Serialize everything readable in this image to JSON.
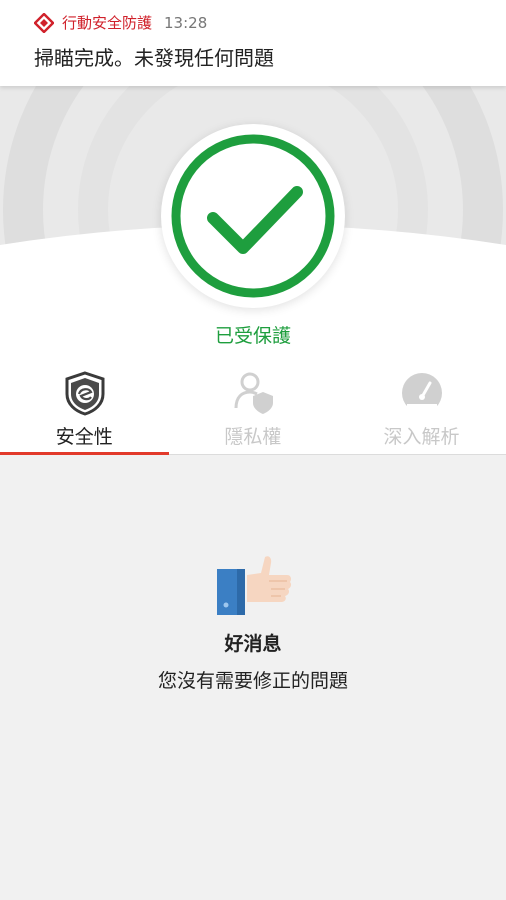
{
  "notification": {
    "app_name": "行動安全防護",
    "time": "13:28",
    "message": "掃瞄完成。未發現任何問題"
  },
  "hero": {
    "status_label": "已受保護",
    "status_icon": "checkmark-circle-icon"
  },
  "tabs": [
    {
      "label": "安全性",
      "icon": "shield-icon",
      "active": true
    },
    {
      "label": "隱私權",
      "icon": "privacy-user-shield-icon",
      "active": false
    },
    {
      "label": "深入解析",
      "icon": "speedometer-icon",
      "active": false
    }
  ],
  "good_news": {
    "icon": "thumbs-up-icon",
    "title": "好消息",
    "subtitle": "您沒有需要修正的問題"
  },
  "colors": {
    "brand_red": "#d0212b",
    "protected_green": "#1e9e3e",
    "tab_underline": "#e23a2b"
  }
}
